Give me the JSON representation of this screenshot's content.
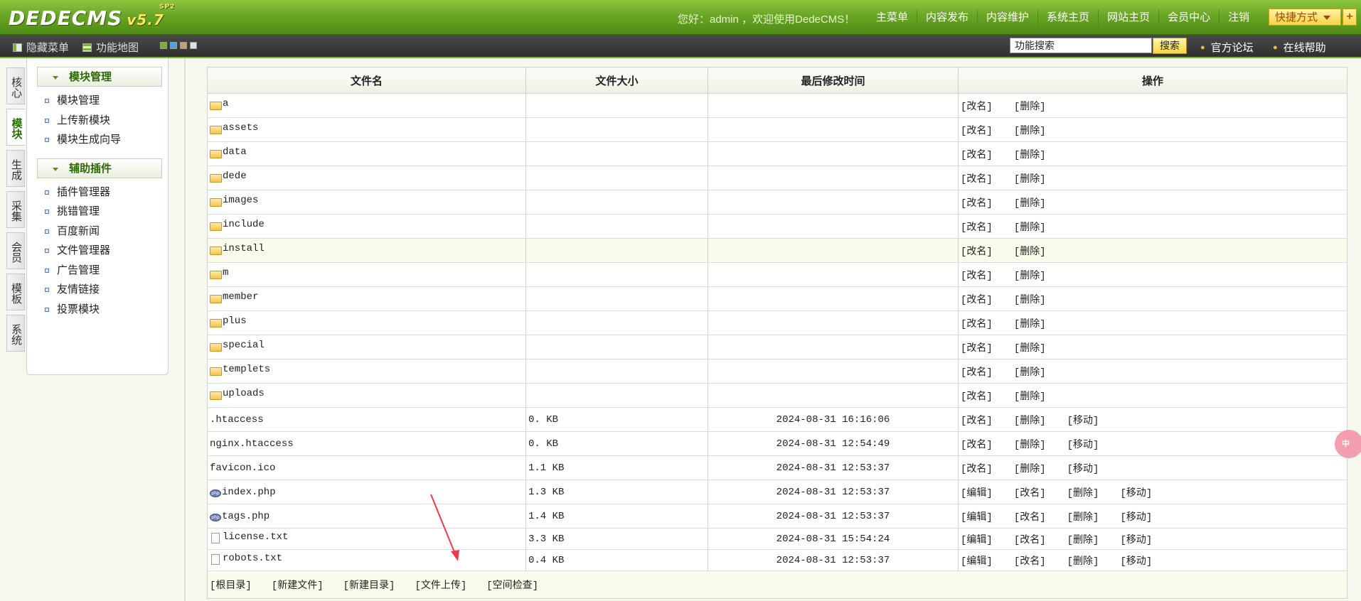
{
  "header": {
    "logo": "DEDECMS",
    "version": "v5.7",
    "beta": "SP2",
    "welcome": "您好：admin ，欢迎使用DedeCMS！",
    "nav": [
      "主菜单",
      "内容发布",
      "内容维护",
      "系统主页",
      "网站主页",
      "会员中心",
      "注销"
    ],
    "quick_label": "快捷方式",
    "quick_plus": "+"
  },
  "subbar": {
    "hide_menu": "隐藏菜单",
    "func_map": "功能地图",
    "skin_colors": [
      "#7ab230",
      "#4aa6e0",
      "#c8a070",
      "#e0e0e0"
    ],
    "search_value": "功能搜索",
    "search_button": "搜索",
    "forum": "官方论坛",
    "help": "在线帮助"
  },
  "vtabs": [
    {
      "label": "核心",
      "active": false
    },
    {
      "label": "模块",
      "active": true
    },
    {
      "label": "生成",
      "active": false
    },
    {
      "label": "采集",
      "active": false
    },
    {
      "label": "会员",
      "active": false
    },
    {
      "label": "模板",
      "active": false
    },
    {
      "label": "系统",
      "active": false
    }
  ],
  "menu": {
    "groups": [
      {
        "title": "模块管理",
        "items": [
          "模块管理",
          "上传新模块",
          "模块生成向导"
        ]
      },
      {
        "title": "辅助插件",
        "items": [
          "插件管理器",
          "挑错管理",
          "百度新闻",
          "文件管理器",
          "广告管理",
          "友情链接",
          "投票模块"
        ]
      }
    ]
  },
  "table": {
    "headers": [
      "文件名",
      "文件大小",
      "最后修改时间",
      "操作"
    ],
    "rows": [
      {
        "name": "a",
        "type": "folder",
        "size": "",
        "time": "",
        "ops": [
          "[改名]",
          "[删除]"
        ]
      },
      {
        "name": "assets",
        "type": "folder",
        "size": "",
        "time": "",
        "ops": [
          "[改名]",
          "[删除]"
        ]
      },
      {
        "name": "data",
        "type": "folder",
        "size": "",
        "time": "",
        "ops": [
          "[改名]",
          "[删除]"
        ]
      },
      {
        "name": "dede",
        "type": "folder",
        "size": "",
        "time": "",
        "ops": [
          "[改名]",
          "[删除]"
        ]
      },
      {
        "name": "images",
        "type": "folder",
        "size": "",
        "time": "",
        "ops": [
          "[改名]",
          "[删除]"
        ]
      },
      {
        "name": "include",
        "type": "folder",
        "size": "",
        "time": "",
        "ops": [
          "[改名]",
          "[删除]"
        ]
      },
      {
        "name": "install",
        "type": "folder",
        "size": "",
        "time": "",
        "ops": [
          "[改名]",
          "[删除]"
        ],
        "highlight": true
      },
      {
        "name": "m",
        "type": "folder",
        "size": "",
        "time": "",
        "ops": [
          "[改名]",
          "[删除]"
        ]
      },
      {
        "name": "member",
        "type": "folder",
        "size": "",
        "time": "",
        "ops": [
          "[改名]",
          "[删除]"
        ]
      },
      {
        "name": "plus",
        "type": "folder",
        "size": "",
        "time": "",
        "ops": [
          "[改名]",
          "[删除]"
        ]
      },
      {
        "name": "special",
        "type": "folder",
        "size": "",
        "time": "",
        "ops": [
          "[改名]",
          "[删除]"
        ]
      },
      {
        "name": "templets",
        "type": "folder",
        "size": "",
        "time": "",
        "ops": [
          "[改名]",
          "[删除]"
        ]
      },
      {
        "name": "uploads",
        "type": "folder",
        "size": "",
        "time": "",
        "ops": [
          "[改名]",
          "[删除]"
        ]
      },
      {
        "name": ".htaccess",
        "type": "plain",
        "size": "0. KB",
        "time": "2024-08-31 16:16:06",
        "ops": [
          "[改名]",
          "[删除]",
          "[移动]"
        ]
      },
      {
        "name": "nginx.htaccess",
        "type": "plain",
        "size": "0. KB",
        "time": "2024-08-31 12:54:49",
        "ops": [
          "[改名]",
          "[删除]",
          "[移动]"
        ]
      },
      {
        "name": "favicon.ico",
        "type": "plain",
        "size": "1.1 KB",
        "time": "2024-08-31 12:53:37",
        "ops": [
          "[改名]",
          "[删除]",
          "[移动]"
        ]
      },
      {
        "name": "index.php",
        "type": "php",
        "size": "1.3 KB",
        "time": "2024-08-31 12:53:37",
        "ops": [
          "[编辑]",
          "[改名]",
          "[删除]",
          "[移动]"
        ]
      },
      {
        "name": "tags.php",
        "type": "php",
        "size": "1.4 KB",
        "time": "2024-08-31 12:53:37",
        "ops": [
          "[编辑]",
          "[改名]",
          "[删除]",
          "[移动]"
        ]
      },
      {
        "name": "license.txt",
        "type": "txt",
        "size": "3.3 KB",
        "time": "2024-08-31 15:54:24",
        "ops": [
          "[编辑]",
          "[改名]",
          "[删除]",
          "[移动]"
        ],
        "short": true
      },
      {
        "name": "robots.txt",
        "type": "txt",
        "size": "0.4 KB",
        "time": "2024-08-31 12:53:37",
        "ops": [
          "[编辑]",
          "[改名]",
          "[删除]",
          "[移动]"
        ],
        "short": true
      }
    ],
    "footer_links": [
      "[根目录]",
      "[新建文件]",
      "[新建目录]",
      "[文件上传]",
      "[空间检查]"
    ]
  },
  "float_badge": "中"
}
